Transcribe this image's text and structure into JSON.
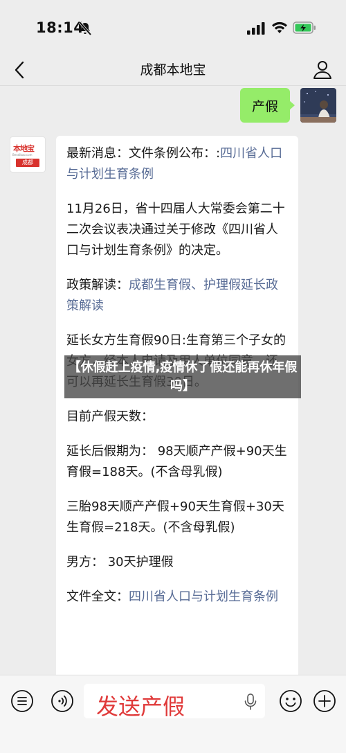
{
  "status": {
    "time": "18:14"
  },
  "nav": {
    "title": "成都本地宝"
  },
  "chat": {
    "outgoing": "产假",
    "bot_logo": {
      "name": "本地宝",
      "url": "Bendibao.com",
      "city": "成都"
    },
    "incoming": {
      "p1_prefix": "最新消息：文件条例公布：:",
      "p1_link": "四川省人口与计划生育条例",
      "p2": "11月26日，省十四届人大常委会第二十二次会议表决通过关于修改《四川省人口与计划生育条例》的决定。",
      "p3_prefix": "政策解读：",
      "p3_link": "成都生育假、护理假延长政策解读",
      "p4": "延长女方生育假90日:生育第三个子女的女方，经本人申请及用人单位同意，还可以再延长生育假30日。",
      "p5": "目前产假天数：",
      "p6": "延长后假期为： 98天顺产产假+90天生育假=188天。(不含母乳假)",
      "p7": "三胎98天顺产产假+90天生育假+30天生育假=218天。(不含母乳假)",
      "p8": "男方： 30天护理假",
      "p9_prefix": "文件全文：",
      "p9_link": "四川省人口与计划生育条例"
    }
  },
  "banner": {
    "text": "【休假赶上疫情,疫情休了假还能再休年假吗】"
  },
  "input": {
    "value": "发送产假"
  },
  "icons": [
    "bell-slash-icon",
    "signal-icon",
    "wifi-icon",
    "battery-icon",
    "back-chevron-icon",
    "person-icon",
    "menu-icon",
    "voice-icon",
    "mic-icon",
    "emoji-icon",
    "plus-icon"
  ]
}
